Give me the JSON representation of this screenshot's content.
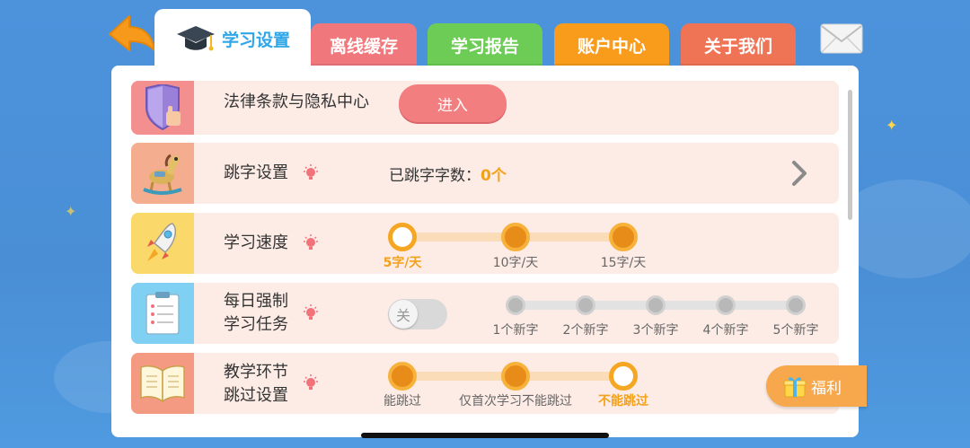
{
  "tabs": [
    {
      "label": "学习设置",
      "color": "#ffffff",
      "active": true
    },
    {
      "label": "离线缓存",
      "color": "#f0787c"
    },
    {
      "label": "学习报告",
      "color": "#6ccc55"
    },
    {
      "label": "账户中心",
      "color": "#f99b1b"
    },
    {
      "label": "关于我们",
      "color": "#ef7355"
    }
  ],
  "rows": {
    "legal": {
      "label": "法律条款与隐私中心",
      "button": "进入",
      "icon": "shield-hand-icon"
    },
    "skip": {
      "label": "跳字设置",
      "info_prefix": "已跳字字数：",
      "info_value": "0个",
      "icon": "horse-toy-icon"
    },
    "speed": {
      "label": "学习速度",
      "icon": "rocket-icon",
      "options": [
        "5字/天",
        "10字/天",
        "15字/天"
      ],
      "selected_index": 0
    },
    "daily": {
      "label_line1": "每日强制",
      "label_line2": "学习任务",
      "icon": "checklist-icon",
      "toggle_label": "关",
      "toggle_on": false,
      "options": [
        "1个新字",
        "2个新字",
        "3个新字",
        "4个新字",
        "5个新字"
      ]
    },
    "teach": {
      "label_line1": "教学环节",
      "label_line2": "跳过设置",
      "icon": "open-book-icon",
      "options": [
        "能跳过",
        "仅首次学习不能跳过",
        "不能跳过"
      ],
      "selected_index": 2
    }
  },
  "fuli": {
    "label": "福利"
  },
  "colors": {
    "accent": "#f5a623",
    "panel_row": "#fdece6",
    "active_tab_text": "#2fa6e8"
  }
}
